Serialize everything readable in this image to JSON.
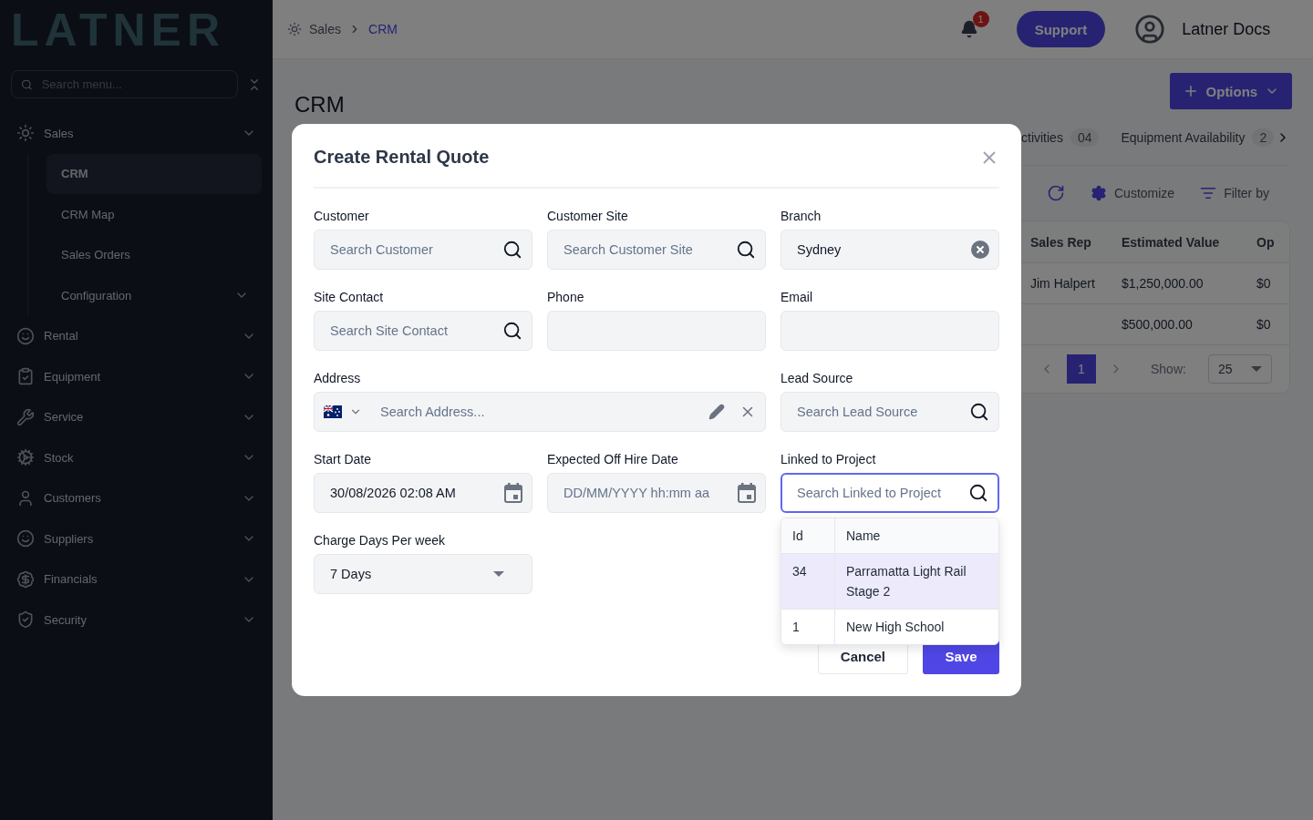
{
  "sidebar": {
    "logo": "LATNER",
    "search_placeholder": "Search menu...",
    "items": [
      {
        "label": "Sales",
        "children": [
          {
            "label": "CRM",
            "selected": true
          },
          {
            "label": "CRM Map",
            "selected": false
          },
          {
            "label": "Sales Orders",
            "selected": false
          },
          {
            "label": "Configuration",
            "selected": false,
            "has_submenu": true
          }
        ]
      },
      {
        "label": "Rental"
      },
      {
        "label": "Equipment"
      },
      {
        "label": "Service"
      },
      {
        "label": "Stock"
      },
      {
        "label": "Customers"
      },
      {
        "label": "Suppliers"
      },
      {
        "label": "Financials"
      },
      {
        "label": "Security"
      }
    ]
  },
  "header": {
    "breadcrumb": [
      "Sales",
      "CRM"
    ],
    "notification_count": "1",
    "support_button": "Support",
    "user_name": "Latner Docs"
  },
  "page": {
    "title": "CRM",
    "options_button": "Options",
    "tabs": [
      {
        "label": "ctivities",
        "count": "04"
      },
      {
        "label": "Equipment Availability",
        "count": "2"
      }
    ],
    "toolbar": {
      "customize": "Customize",
      "filter": "Filter by"
    },
    "table": {
      "columns": [
        "Sales Rep",
        "Estimated Value",
        "Op"
      ],
      "rows": [
        {
          "sales_rep": "Jim Halpert",
          "estimated_value": "$1,250,000.00",
          "column_3": "$0"
        },
        {
          "estimated_value": "$500,000.00",
          "column_3": "$0"
        }
      ]
    },
    "pagination": {
      "page": "1",
      "show_label": "Show:",
      "page_size": "25"
    }
  },
  "modal": {
    "title": "Create Rental Quote",
    "fields": [
      {
        "kind": "search",
        "label": "Customer",
        "placeholder": "Search Customer"
      },
      {
        "kind": "search",
        "label": "Customer Site",
        "placeholder": "Search Customer Site"
      },
      {
        "kind": "clearable",
        "label": "Branch",
        "value": "Sydney"
      },
      {
        "kind": "search",
        "label": "Site Contact",
        "placeholder": "Search Site Contact"
      },
      {
        "kind": "text",
        "label": "Phone"
      },
      {
        "kind": "text",
        "label": "Email"
      },
      {
        "kind": "address",
        "label": "Address",
        "placeholder": "Search Address..."
      },
      {
        "kind": "search",
        "label": "Lead Source",
        "placeholder": "Search Lead Source"
      },
      {
        "kind": "date",
        "label": "Start Date",
        "value": "30/08/2026 02:08 AM"
      },
      {
        "kind": "date",
        "label": "Expected Off Hire Date",
        "placeholder": "DD/MM/YYYY hh:mm aa"
      },
      {
        "kind": "search",
        "label": "Linked to Project",
        "placeholder": "Search Linked to Project",
        "focused": true,
        "dropdown": {
          "columns": [
            "Id",
            "Name"
          ],
          "rows": [
            {
              "id": "34",
              "name": "Parramatta Light Rail Stage 2",
              "selected": true
            },
            {
              "id": "1",
              "name": "New High School",
              "selected": false
            }
          ]
        }
      },
      {
        "kind": "select",
        "label": "Charge Days Per week",
        "value": "7 Days"
      }
    ],
    "buttons": {
      "cancel": "Cancel",
      "save": "Save"
    }
  }
}
